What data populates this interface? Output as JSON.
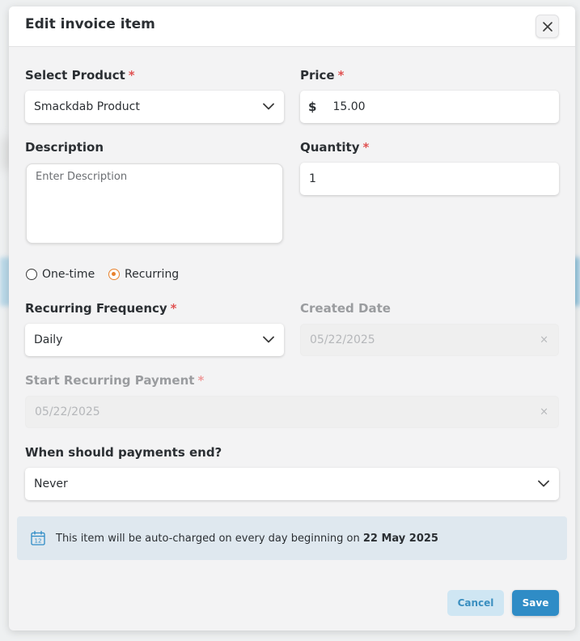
{
  "modal": {
    "title": "Edit invoice item",
    "close_icon": "close-icon"
  },
  "product": {
    "label": "Select Product",
    "required": "*",
    "value": "Smackdab Product"
  },
  "price": {
    "label": "Price",
    "required": "*",
    "currency_symbol": "$",
    "value": "15.00"
  },
  "description": {
    "label": "Description",
    "placeholder": "Enter Description"
  },
  "quantity": {
    "label": "Quantity",
    "required": "*",
    "value": "1"
  },
  "billing_type": {
    "options": [
      "One-time",
      "Recurring"
    ],
    "selected": "Recurring"
  },
  "recurring_frequency": {
    "label": "Recurring Frequency",
    "required": "*",
    "value": "Daily"
  },
  "created_date": {
    "label": "Created Date",
    "value": "05/22/2025",
    "clear": "×"
  },
  "start_recurring": {
    "label": "Start Recurring Payment",
    "required": "*",
    "value": "05/22/2025",
    "clear": "×"
  },
  "payments_end": {
    "label": "When should payments end?",
    "value": "Never"
  },
  "info": {
    "icon": "calendar-icon",
    "calendar_day": "12",
    "text_prefix": "This item will be auto-charged on every day beginning on ",
    "date": "22 May 2025"
  },
  "footer": {
    "cancel_label": "Cancel",
    "save_label": "Save"
  },
  "colors": {
    "accent": "#2f8cc6",
    "radio_selected": "#e8822e",
    "required": "#e05252"
  }
}
